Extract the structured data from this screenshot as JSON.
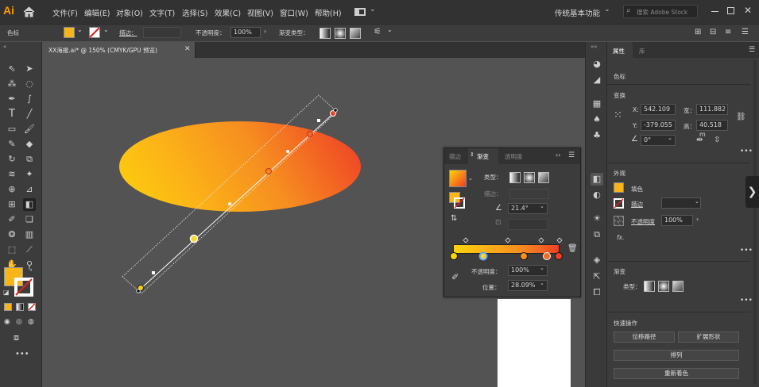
{
  "app": {
    "logo": "Ai"
  },
  "menu": [
    "文件(F)",
    "编辑(E)",
    "对象(O)",
    "文字(T)",
    "选择(S)",
    "效果(C)",
    "视图(V)",
    "窗口(W)",
    "帮助(H)"
  ],
  "workspace": "传统基本功能",
  "search": {
    "placeholder": "搜索 Adobe Stock"
  },
  "control": {
    "selection_label": "色标",
    "stroke_label": "描边：",
    "opacity_label": "不透明度：",
    "opacity_value": "100%",
    "gradient_type_label": "渐变类型："
  },
  "document_tab": {
    "title": "XX海报.ai* @ 150% (CMYK/GPU 预览)"
  },
  "gradient_panel": {
    "tabs": [
      "描边",
      "渐变",
      "透明度"
    ],
    "type_label": "类型：",
    "stroke_label": "描边：",
    "angle_value": "21.4°",
    "opacity_label": "不透明度：",
    "opacity_value": "100%",
    "position_label": "位置：",
    "position_value": "28.09%"
  },
  "properties": {
    "tabs": [
      "属性",
      "库"
    ],
    "section_color_stop": "色标",
    "transform_title": "变换",
    "x_label": "X:",
    "x_value": "542.109",
    "y_label": "Y:",
    "y_value": "-379.055",
    "w_label": "宽：",
    "w_value": "111.882",
    "h_label": "高：",
    "h_value": "40.518 m",
    "angle_value": "0°",
    "appearance_title": "外观",
    "fill_label": "填色",
    "stroke_label": "描边",
    "opacity_label": "不透明度",
    "opacity_value": "100%",
    "fx_label": "fx.",
    "gradient_title": "渐变",
    "gradient_type_label": "类型：",
    "quick_actions_title": "快速操作",
    "offset_path_btn": "位移路径",
    "expand_shape_btn": "扩展形状",
    "arrange_btn": "排列",
    "recolor_btn": "重新着色"
  },
  "colors": {
    "accent": "#f7b519",
    "grad_start": "#fdd20b",
    "grad_end": "#ef3e25",
    "menubar": "#323232",
    "panel": "#3c3c3c",
    "canvas": "#535353"
  }
}
